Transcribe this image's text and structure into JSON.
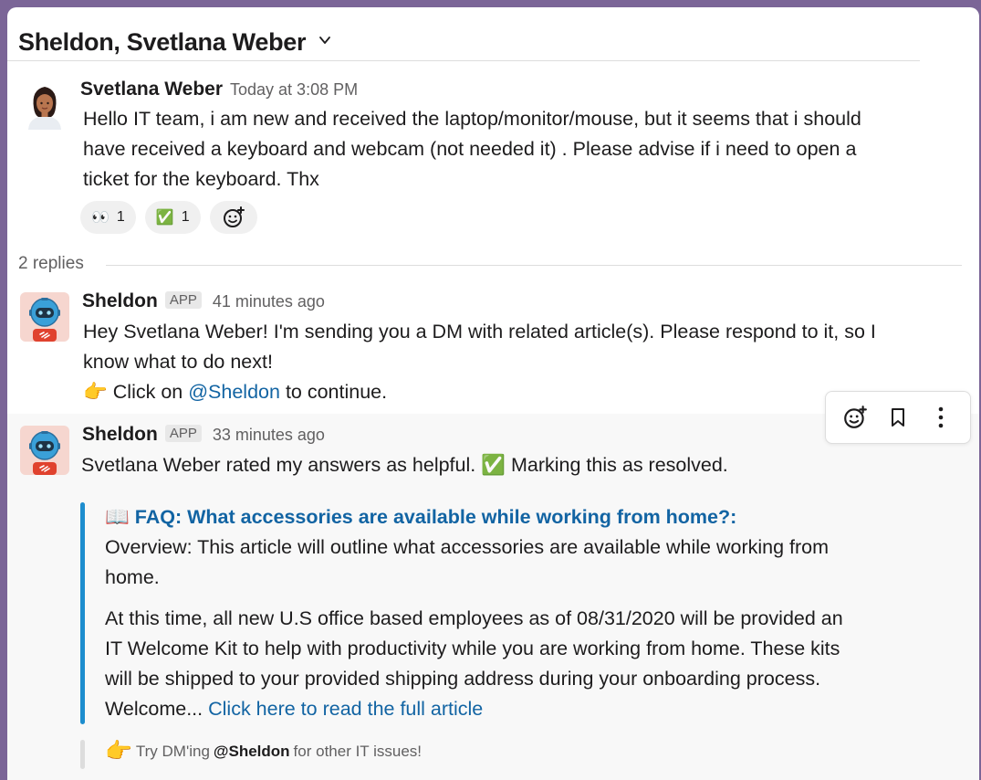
{
  "header": {
    "title": "Sheldon, Svetlana Weber"
  },
  "parent": {
    "author": "Svetlana Weber",
    "timestamp": "Today at 3:08 PM",
    "lines": [
      "Hello IT team, i am new and received the laptop/monitor/mouse, but it seems that i should",
      "have received a keyboard  and webcam (not needed it) .  Please advise if i need to open a",
      "ticket for the keyboard. Thx"
    ],
    "reactions": [
      {
        "emoji": "👀",
        "count": "1"
      },
      {
        "emoji": "✅",
        "count": "1"
      }
    ]
  },
  "thread": {
    "replies_label": "2 replies"
  },
  "reply1": {
    "author": "Sheldon",
    "badge": "APP",
    "timestamp": "41 minutes ago",
    "line1": "Hey Svetlana Weber! I'm sending you a DM with related article(s). Please respond to it, so I",
    "line2": "know what to do next!",
    "pointer_emoji": "👉",
    "line3_pre": "Click on",
    "line3_mention": "@Sheldon",
    "line3_post": "to continue."
  },
  "reply2": {
    "author": "Sheldon",
    "badge": "APP",
    "timestamp": "33 minutes ago",
    "line_pre": "Svetlana Weber",
    "line_mid": "rated my answers as helpful.",
    "check_emoji": "✅",
    "line_post": "Marking this as resolved.",
    "attachment": {
      "book_emoji": "📖",
      "title": "FAQ: What accessories are available while working from home?:",
      "overview_1": "Overview: This article will outline what accessories are available while working from",
      "overview_2": "home.",
      "para_1": "At this time, all new U.S office based employees as of 08/31/2020 will be provided an",
      "para_2": "IT Welcome Kit to help with productivity while you are working from home. These kits",
      "para_3": "will be shipped to your provided shipping address during your onboarding process.",
      "para_4_pre": "Welcome...",
      "para_4_link": "Click here to read the full article"
    },
    "footer": {
      "pointer_emoji": "👉",
      "pre": "Try DM'ing",
      "mention": "@Sheldon",
      "post": "for other IT issues!"
    }
  },
  "toolbar": {
    "icons": [
      "add-reaction-icon",
      "bookmark-icon",
      "more-actions-icon"
    ]
  }
}
